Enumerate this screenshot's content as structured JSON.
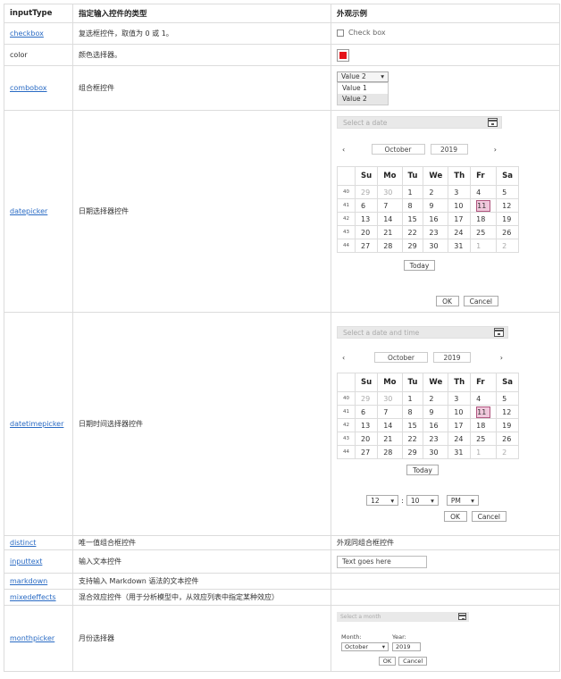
{
  "headers": [
    "inputType",
    "指定输入控件的类型",
    "外观示例"
  ],
  "rows": {
    "checkbox": {
      "name": "checkbox",
      "desc": "复选框控件，取值为 0 或 1。",
      "label": "Check box"
    },
    "color": {
      "name": "color",
      "desc": "颜色选择器。",
      "swatch": "#e5141a"
    },
    "combobox": {
      "name": "combobox",
      "desc": "组合框控件",
      "selected": "Value 2",
      "arrow": "▾",
      "options": [
        "Value 1",
        "Value 2"
      ]
    },
    "datepicker": {
      "name": "datepicker",
      "desc": "日期选择器控件",
      "placeholder": "Select a date",
      "prev": "‹",
      "next": "›",
      "month": "October",
      "year": "2019",
      "today": "Today",
      "ok": "OK",
      "cancel": "Cancel"
    },
    "datetimepicker": {
      "name": "datetimepicker",
      "desc": "日期时间选择器控件",
      "placeholder": "Select a date and time",
      "prev": "‹",
      "next": "›",
      "month": "October",
      "year": "2019",
      "today": "Today",
      "hour": "12",
      "minute": "10",
      "ampm": "PM",
      "sep": ":",
      "ok": "OK",
      "cancel": "Cancel"
    },
    "distinct": {
      "name": "distinct",
      "desc": "唯一值组合框控件",
      "example": "外观同组合框控件"
    },
    "inputtext": {
      "name": "inputtext",
      "desc": "输入文本控件",
      "value": "Text goes here"
    },
    "markdown": {
      "name": "markdown",
      "desc": "支持输入 Markdown 语法的文本控件"
    },
    "mixedeffects": {
      "name": "mixedeffects",
      "desc": "混合效应控件（用于分析模型中，从效应列表中指定某种效应）"
    },
    "monthpicker": {
      "name": "monthpicker",
      "desc": "月份选择器",
      "placeholder": "Select a month",
      "month_label": "Month:",
      "year_label": "Year:",
      "month": "October",
      "year": "2019",
      "ok": "OK",
      "cancel": "Cancel"
    }
  },
  "calendar": {
    "weekdays": [
      "Su",
      "Mo",
      "Tu",
      "We",
      "Th",
      "Fr",
      "Sa"
    ],
    "weeks": [
      {
        "wk": "40",
        "days": [
          "29",
          "30",
          "1",
          "2",
          "3",
          "4",
          "5"
        ]
      },
      {
        "wk": "41",
        "days": [
          "6",
          "7",
          "8",
          "9",
          "10",
          "11",
          "12"
        ]
      },
      {
        "wk": "42",
        "days": [
          "13",
          "14",
          "15",
          "16",
          "17",
          "18",
          "19"
        ]
      },
      {
        "wk": "43",
        "days": [
          "20",
          "21",
          "22",
          "23",
          "24",
          "25",
          "26"
        ]
      },
      {
        "wk": "44",
        "days": [
          "27",
          "28",
          "29",
          "30",
          "31",
          "1",
          "2"
        ]
      }
    ],
    "dim_days": [
      [
        0,
        0
      ],
      [
        0,
        1
      ],
      [
        4,
        5
      ],
      [
        4,
        6
      ]
    ],
    "selected": [
      1,
      5
    ]
  }
}
